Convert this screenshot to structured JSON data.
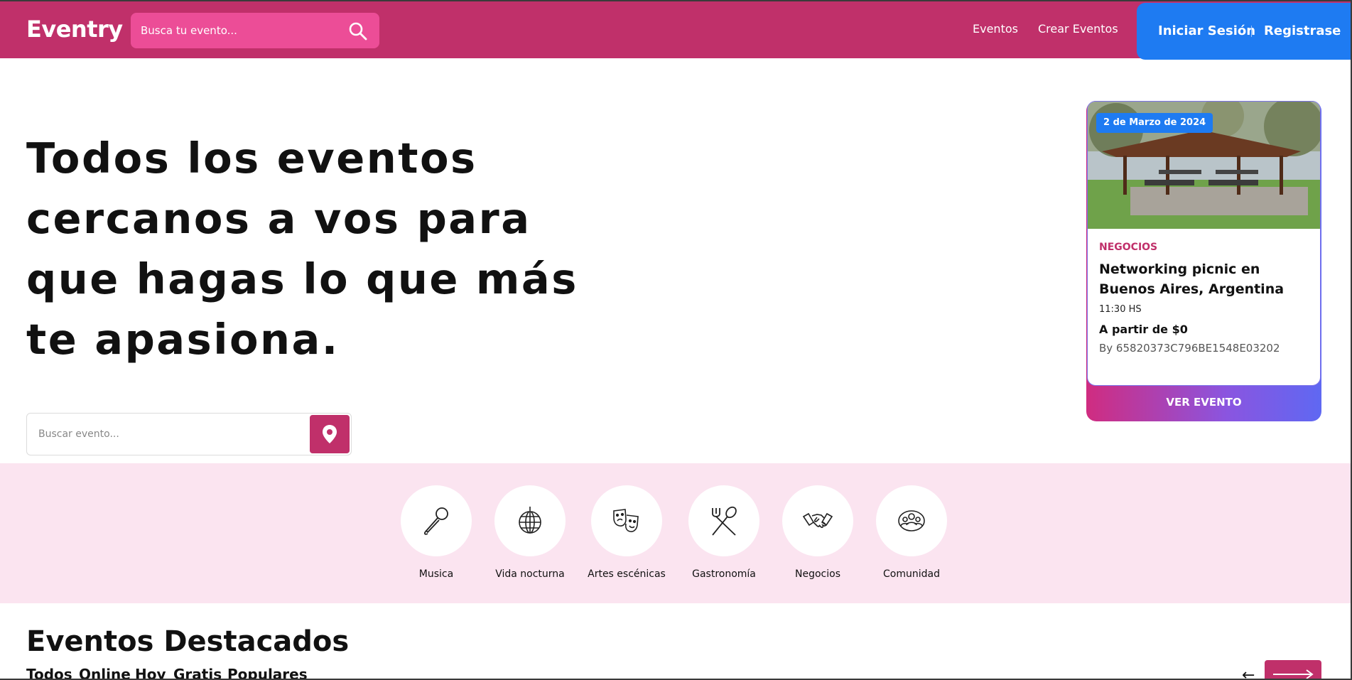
{
  "header": {
    "logo": "Eventry",
    "search_placeholder": "Busca tu evento...",
    "nav": [
      "Eventos",
      "Crear Eventos"
    ],
    "login": "Iniciar Sesión",
    "register": "Registrase"
  },
  "hero": {
    "title": "Todos los eventos cercanos a vos para que hagas lo que más te apasiona.",
    "search_placeholder": "Buscar evento..."
  },
  "event_card": {
    "date": "2 de Marzo de 2024",
    "category": "NEGOCIOS",
    "title": "Networking picnic en Buenos Aires, Argentina",
    "time": "11:30 HS",
    "price": "A partir de $0",
    "by": "By 65820373C796BE1548E03202",
    "button": "VER EVENTO"
  },
  "categories": [
    {
      "label": "Musica",
      "icon": "microphone-icon"
    },
    {
      "label": "Vida nocturna",
      "icon": "disco-ball-icon"
    },
    {
      "label": "Artes escénicas",
      "icon": "theater-masks-icon"
    },
    {
      "label": "Gastronomía",
      "icon": "fork-spoon-icon"
    },
    {
      "label": "Negocios",
      "icon": "handshake-icon"
    },
    {
      "label": "Comunidad",
      "icon": "community-icon"
    }
  ],
  "featured": {
    "title": "Eventos Destacados",
    "filters": [
      "Todos",
      "Online",
      "Hoy",
      "Gratis",
      "Populares"
    ]
  },
  "colors": {
    "brand": "#c0306a",
    "header_search": "#ec4d97",
    "accent_blue": "#1e7bf2",
    "category_band": "#fbe4f0"
  }
}
